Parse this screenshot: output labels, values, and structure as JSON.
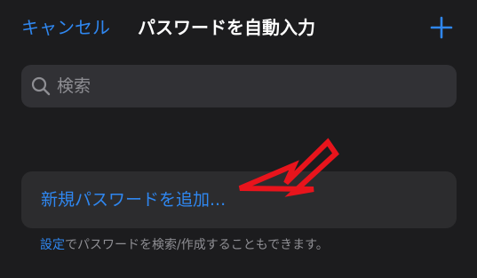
{
  "header": {
    "cancel_label": "キャンセル",
    "title": "パスワードを自動入力",
    "add_icon": "plus-icon"
  },
  "search": {
    "placeholder": "検索",
    "value": "",
    "icon": "search-icon"
  },
  "list": {
    "add_password_label": "新規パスワードを追加..."
  },
  "footer": {
    "link_label": "設定",
    "text": "でパスワードを検索/作成することもできます。"
  },
  "annotation": {
    "type": "red-arrow-outline",
    "points_to": "add-password-button"
  },
  "colors": {
    "background": "#1c1c1e",
    "accent": "#2f87f0",
    "field": "#313135",
    "row": "#2c2c2e",
    "secondary_text": "#8e8e93",
    "arrow": "#e8141c"
  }
}
